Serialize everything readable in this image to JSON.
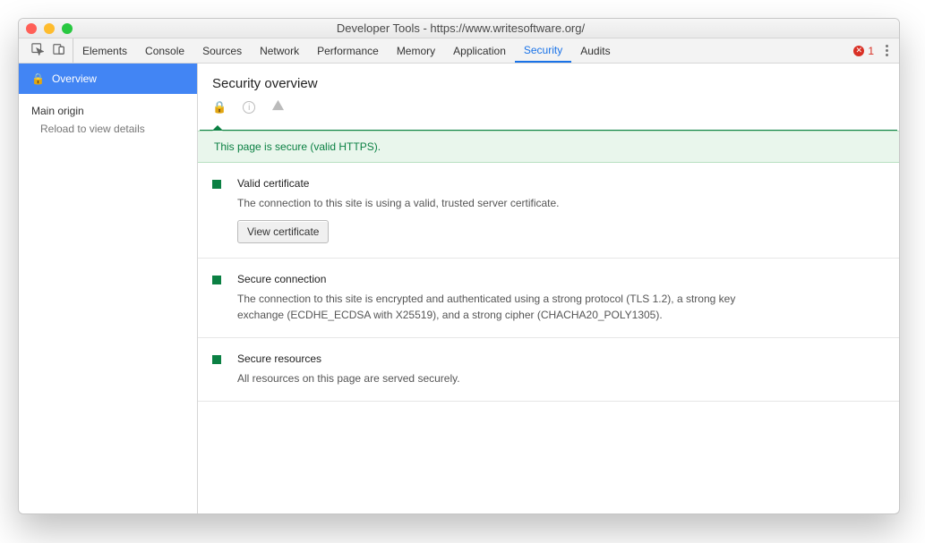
{
  "window": {
    "title": "Developer Tools - https://www.writesoftware.org/"
  },
  "toolbar": {
    "tabs": [
      "Elements",
      "Console",
      "Sources",
      "Network",
      "Performance",
      "Memory",
      "Application",
      "Security",
      "Audits"
    ],
    "active": "Security",
    "error_count": "1"
  },
  "sidebar": {
    "overview": "Overview",
    "main_origin": "Main origin",
    "reload_hint": "Reload to view details"
  },
  "main": {
    "heading": "Security overview",
    "banner": "This page is secure (valid HTTPS).",
    "items": [
      {
        "title": "Valid certificate",
        "desc": "The connection to this site is using a valid, trusted server certificate.",
        "button": "View certificate"
      },
      {
        "title": "Secure connection",
        "desc": "The connection to this site is encrypted and authenticated using a strong protocol (TLS 1.2), a strong key exchange (ECDHE_ECDSA with X25519), and a strong cipher (CHACHA20_POLY1305)."
      },
      {
        "title": "Secure resources",
        "desc": "All resources on this page are served securely."
      }
    ]
  }
}
